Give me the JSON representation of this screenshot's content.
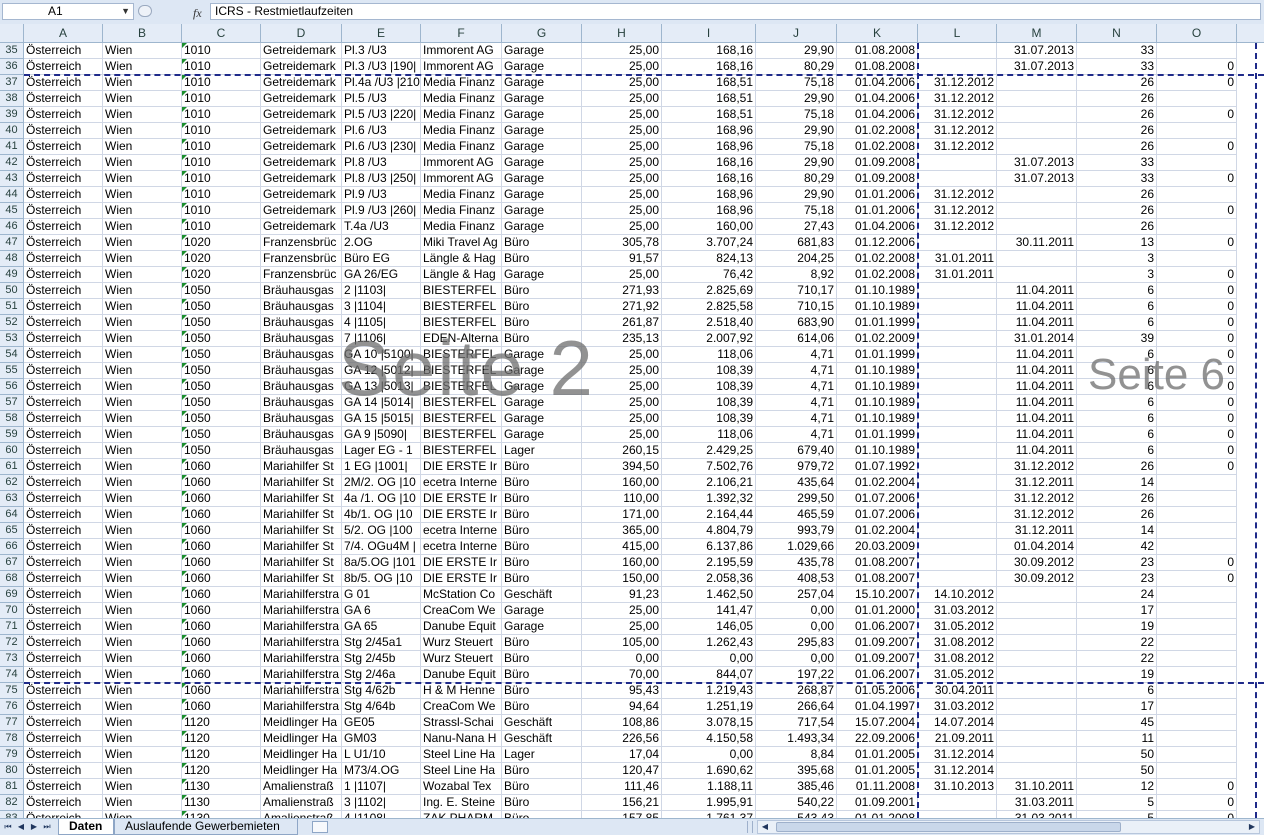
{
  "formula_bar": {
    "cell_ref": "A1",
    "fx": "fx",
    "content": "ICRS - Restmietlaufzeiten"
  },
  "columns": [
    "A",
    "B",
    "C",
    "D",
    "E",
    "F",
    "G",
    "H",
    "I",
    "J",
    "K",
    "L",
    "M",
    "N",
    "O"
  ],
  "rows": [
    {
      "n": "35",
      "a": "Österreich",
      "b": "Wien",
      "c": "1010",
      "d": "Getreidemark",
      "e": "Pl.3 /U3",
      "f": "Immorent AG",
      "g": "Garage",
      "h": "25,00",
      "i": "168,16",
      "j": "29,90",
      "k": "01.08.2008",
      "l": "",
      "m": "31.07.2013",
      "nn": "33",
      "p": ""
    },
    {
      "n": "36",
      "a": "Österreich",
      "b": "Wien",
      "c": "1010",
      "d": "Getreidemark",
      "e": "Pl.3 /U3 |190|",
      "f": "Immorent AG",
      "g": "Garage",
      "h": "25,00",
      "i": "168,16",
      "j": "80,29",
      "k": "01.08.2008",
      "l": "",
      "m": "31.07.2013",
      "nn": "33",
      "p": "0"
    },
    {
      "n": "37",
      "a": "Österreich",
      "b": "Wien",
      "c": "1010",
      "d": "Getreidemark",
      "e": "Pl.4a /U3 |210|",
      "f": "Media Finanz",
      "g": "Garage",
      "h": "25,00",
      "i": "168,51",
      "j": "75,18",
      "k": "01.04.2006",
      "l": "31.12.2012",
      "m": "",
      "nn": "26",
      "p": "0"
    },
    {
      "n": "38",
      "a": "Österreich",
      "b": "Wien",
      "c": "1010",
      "d": "Getreidemark",
      "e": "Pl.5 /U3",
      "f": "Media Finanz",
      "g": "Garage",
      "h": "25,00",
      "i": "168,51",
      "j": "29,90",
      "k": "01.04.2006",
      "l": "31.12.2012",
      "m": "",
      "nn": "26",
      "p": ""
    },
    {
      "n": "39",
      "a": "Österreich",
      "b": "Wien",
      "c": "1010",
      "d": "Getreidemark",
      "e": "Pl.5 /U3 |220|",
      "f": "Media Finanz",
      "g": "Garage",
      "h": "25,00",
      "i": "168,51",
      "j": "75,18",
      "k": "01.04.2006",
      "l": "31.12.2012",
      "m": "",
      "nn": "26",
      "p": "0"
    },
    {
      "n": "40",
      "a": "Österreich",
      "b": "Wien",
      "c": "1010",
      "d": "Getreidemark",
      "e": "Pl.6 /U3",
      "f": "Media Finanz",
      "g": "Garage",
      "h": "25,00",
      "i": "168,96",
      "j": "29,90",
      "k": "01.02.2008",
      "l": "31.12.2012",
      "m": "",
      "nn": "26",
      "p": ""
    },
    {
      "n": "41",
      "a": "Österreich",
      "b": "Wien",
      "c": "1010",
      "d": "Getreidemark",
      "e": "Pl.6 /U3 |230|",
      "f": "Media Finanz",
      "g": "Garage",
      "h": "25,00",
      "i": "168,96",
      "j": "75,18",
      "k": "01.02.2008",
      "l": "31.12.2012",
      "m": "",
      "nn": "26",
      "p": "0"
    },
    {
      "n": "42",
      "a": "Österreich",
      "b": "Wien",
      "c": "1010",
      "d": "Getreidemark",
      "e": "Pl.8 /U3",
      "f": "Immorent AG",
      "g": "Garage",
      "h": "25,00",
      "i": "168,16",
      "j": "29,90",
      "k": "01.09.2008",
      "l": "",
      "m": "31.07.2013",
      "nn": "33",
      "p": ""
    },
    {
      "n": "43",
      "a": "Österreich",
      "b": "Wien",
      "c": "1010",
      "d": "Getreidemark",
      "e": "Pl.8 /U3 |250|",
      "f": "Immorent AG",
      "g": "Garage",
      "h": "25,00",
      "i": "168,16",
      "j": "80,29",
      "k": "01.09.2008",
      "l": "",
      "m": "31.07.2013",
      "nn": "33",
      "p": "0"
    },
    {
      "n": "44",
      "a": "Österreich",
      "b": "Wien",
      "c": "1010",
      "d": "Getreidemark",
      "e": "Pl.9 /U3",
      "f": "Media Finanz",
      "g": "Garage",
      "h": "25,00",
      "i": "168,96",
      "j": "29,90",
      "k": "01.01.2006",
      "l": "31.12.2012",
      "m": "",
      "nn": "26",
      "p": ""
    },
    {
      "n": "45",
      "a": "Österreich",
      "b": "Wien",
      "c": "1010",
      "d": "Getreidemark",
      "e": "Pl.9 /U3 |260|",
      "f": "Media Finanz",
      "g": "Garage",
      "h": "25,00",
      "i": "168,96",
      "j": "75,18",
      "k": "01.01.2006",
      "l": "31.12.2012",
      "m": "",
      "nn": "26",
      "p": "0"
    },
    {
      "n": "46",
      "a": "Österreich",
      "b": "Wien",
      "c": "1010",
      "d": "Getreidemark",
      "e": "T.4a /U3",
      "f": "Media Finanz",
      "g": "Garage",
      "h": "25,00",
      "i": "160,00",
      "j": "27,43",
      "k": "01.04.2006",
      "l": "31.12.2012",
      "m": "",
      "nn": "26",
      "p": ""
    },
    {
      "n": "47",
      "a": "Österreich",
      "b": "Wien",
      "c": "1020",
      "d": "Franzensbrüc",
      "e": "2.OG",
      "f": "Miki Travel Ag",
      "g": "Büro",
      "h": "305,78",
      "i": "3.707,24",
      "j": "681,83",
      "k": "01.12.2006",
      "l": "",
      "m": "30.11.2011",
      "nn": "13",
      "p": "0"
    },
    {
      "n": "48",
      "a": "Österreich",
      "b": "Wien",
      "c": "1020",
      "d": "Franzensbrüc",
      "e": "Büro EG",
      "f": "Längle & Hag",
      "g": "Büro",
      "h": "91,57",
      "i": "824,13",
      "j": "204,25",
      "k": "01.02.2008",
      "l": "31.01.2011",
      "m": "",
      "nn": "3",
      "p": ""
    },
    {
      "n": "49",
      "a": "Österreich",
      "b": "Wien",
      "c": "1020",
      "d": "Franzensbrüc",
      "e": "GA 26/EG",
      "f": "Längle & Hag",
      "g": "Garage",
      "h": "25,00",
      "i": "76,42",
      "j": "8,92",
      "k": "01.02.2008",
      "l": "31.01.2011",
      "m": "",
      "nn": "3",
      "p": "0"
    },
    {
      "n": "50",
      "a": "Österreich",
      "b": "Wien",
      "c": "1050",
      "d": "Bräuhausgas",
      "e": "2 |1103|",
      "f": "BIESTERFEL",
      "g": "Büro",
      "h": "271,93",
      "i": "2.825,69",
      "j": "710,17",
      "k": "01.10.1989",
      "l": "",
      "m": "11.04.2011",
      "nn": "6",
      "p": "0"
    },
    {
      "n": "51",
      "a": "Österreich",
      "b": "Wien",
      "c": "1050",
      "d": "Bräuhausgas",
      "e": "3 |1104|",
      "f": "BIESTERFEL",
      "g": "Büro",
      "h": "271,92",
      "i": "2.825,58",
      "j": "710,15",
      "k": "01.10.1989",
      "l": "",
      "m": "11.04.2011",
      "nn": "6",
      "p": "0"
    },
    {
      "n": "52",
      "a": "Österreich",
      "b": "Wien",
      "c": "1050",
      "d": "Bräuhausgas",
      "e": "4 |1105|",
      "f": "BIESTERFEL",
      "g": "Büro",
      "h": "261,87",
      "i": "2.518,40",
      "j": "683,90",
      "k": "01.01.1999",
      "l": "",
      "m": "11.04.2011",
      "nn": "6",
      "p": "0"
    },
    {
      "n": "53",
      "a": "Österreich",
      "b": "Wien",
      "c": "1050",
      "d": "Bräuhausgas",
      "e": "7 |1106|",
      "f": "EDEN-Alterna",
      "g": "Büro",
      "h": "235,13",
      "i": "2.007,92",
      "j": "614,06",
      "k": "01.02.2009",
      "l": "",
      "m": "31.01.2014",
      "nn": "39",
      "p": "0"
    },
    {
      "n": "54",
      "a": "Österreich",
      "b": "Wien",
      "c": "1050",
      "d": "Bräuhausgas",
      "e": "GA 10 |5100|",
      "f": "BIESTERFEL",
      "g": "Garage",
      "h": "25,00",
      "i": "118,06",
      "j": "4,71",
      "k": "01.01.1999",
      "l": "",
      "m": "11.04.2011",
      "nn": "6",
      "p": "0"
    },
    {
      "n": "55",
      "a": "Österreich",
      "b": "Wien",
      "c": "1050",
      "d": "Bräuhausgas",
      "e": "GA 12 |5012|",
      "f": "BIESTERFEL",
      "g": "Garage",
      "h": "25,00",
      "i": "108,39",
      "j": "4,71",
      "k": "01.10.1989",
      "l": "",
      "m": "11.04.2011",
      "nn": "6",
      "p": "0"
    },
    {
      "n": "56",
      "a": "Österreich",
      "b": "Wien",
      "c": "1050",
      "d": "Bräuhausgas",
      "e": "GA 13 |5013|",
      "f": "BIESTERFEL",
      "g": "Garage",
      "h": "25,00",
      "i": "108,39",
      "j": "4,71",
      "k": "01.10.1989",
      "l": "",
      "m": "11.04.2011",
      "nn": "6",
      "p": "0"
    },
    {
      "n": "57",
      "a": "Österreich",
      "b": "Wien",
      "c": "1050",
      "d": "Bräuhausgas",
      "e": "GA 14 |5014|",
      "f": "BIESTERFEL",
      "g": "Garage",
      "h": "25,00",
      "i": "108,39",
      "j": "4,71",
      "k": "01.10.1989",
      "l": "",
      "m": "11.04.2011",
      "nn": "6",
      "p": "0"
    },
    {
      "n": "58",
      "a": "Österreich",
      "b": "Wien",
      "c": "1050",
      "d": "Bräuhausgas",
      "e": "GA 15 |5015|",
      "f": "BIESTERFEL",
      "g": "Garage",
      "h": "25,00",
      "i": "108,39",
      "j": "4,71",
      "k": "01.10.1989",
      "l": "",
      "m": "11.04.2011",
      "nn": "6",
      "p": "0"
    },
    {
      "n": "59",
      "a": "Österreich",
      "b": "Wien",
      "c": "1050",
      "d": "Bräuhausgas",
      "e": "GA 9 |5090|",
      "f": "BIESTERFEL",
      "g": "Garage",
      "h": "25,00",
      "i": "118,06",
      "j": "4,71",
      "k": "01.01.1999",
      "l": "",
      "m": "11.04.2011",
      "nn": "6",
      "p": "0"
    },
    {
      "n": "60",
      "a": "Österreich",
      "b": "Wien",
      "c": "1050",
      "d": "Bräuhausgas",
      "e": "Lager EG - 1",
      "f": "BIESTERFEL",
      "g": "Lager",
      "h": "260,15",
      "i": "2.429,25",
      "j": "679,40",
      "k": "01.10.1989",
      "l": "",
      "m": "11.04.2011",
      "nn": "6",
      "p": "0"
    },
    {
      "n": "61",
      "a": "Österreich",
      "b": "Wien",
      "c": "1060",
      "d": "Mariahilfer St",
      "e": "1 EG |1001|",
      "f": "DIE ERSTE Ir",
      "g": "Büro",
      "h": "394,50",
      "i": "7.502,76",
      "j": "979,72",
      "k": "01.07.1992",
      "l": "",
      "m": "31.12.2012",
      "nn": "26",
      "p": "0"
    },
    {
      "n": "62",
      "a": "Österreich",
      "b": "Wien",
      "c": "1060",
      "d": "Mariahilfer St",
      "e": "2M/2. OG |10",
      "f": "ecetra Interne",
      "g": "Büro",
      "h": "160,00",
      "i": "2.106,21",
      "j": "435,64",
      "k": "01.02.2004",
      "l": "",
      "m": "31.12.2011",
      "nn": "14",
      "p": ""
    },
    {
      "n": "63",
      "a": "Österreich",
      "b": "Wien",
      "c": "1060",
      "d": "Mariahilfer St",
      "e": "4a /1. OG |10",
      "f": "DIE ERSTE Ir",
      "g": "Büro",
      "h": "110,00",
      "i": "1.392,32",
      "j": "299,50",
      "k": "01.07.2006",
      "l": "",
      "m": "31.12.2012",
      "nn": "26",
      "p": ""
    },
    {
      "n": "64",
      "a": "Österreich",
      "b": "Wien",
      "c": "1060",
      "d": "Mariahilfer St",
      "e": "4b/1. OG |10",
      "f": "DIE ERSTE Ir",
      "g": "Büro",
      "h": "171,00",
      "i": "2.164,44",
      "j": "465,59",
      "k": "01.07.2006",
      "l": "",
      "m": "31.12.2012",
      "nn": "26",
      "p": ""
    },
    {
      "n": "65",
      "a": "Österreich",
      "b": "Wien",
      "c": "1060",
      "d": "Mariahilfer St",
      "e": "5/2. OG |100",
      "f": "ecetra Interne",
      "g": "Büro",
      "h": "365,00",
      "i": "4.804,79",
      "j": "993,79",
      "k": "01.02.2004",
      "l": "",
      "m": "31.12.2011",
      "nn": "14",
      "p": ""
    },
    {
      "n": "66",
      "a": "Österreich",
      "b": "Wien",
      "c": "1060",
      "d": "Mariahilfer St",
      "e": "7/4. OGu4M |",
      "f": "ecetra Interne",
      "g": "Büro",
      "h": "415,00",
      "i": "6.137,86",
      "j": "1.029,66",
      "k": "20.03.2009",
      "l": "",
      "m": "01.04.2014",
      "nn": "42",
      "p": ""
    },
    {
      "n": "67",
      "a": "Österreich",
      "b": "Wien",
      "c": "1060",
      "d": "Mariahilfer St",
      "e": "8a/5.OG |101",
      "f": "DIE ERSTE Ir",
      "g": "Büro",
      "h": "160,00",
      "i": "2.195,59",
      "j": "435,78",
      "k": "01.08.2007",
      "l": "",
      "m": "30.09.2012",
      "nn": "23",
      "p": "0"
    },
    {
      "n": "68",
      "a": "Österreich",
      "b": "Wien",
      "c": "1060",
      "d": "Mariahilfer St",
      "e": "8b/5. OG |10",
      "f": "DIE ERSTE Ir",
      "g": "Büro",
      "h": "150,00",
      "i": "2.058,36",
      "j": "408,53",
      "k": "01.08.2007",
      "l": "",
      "m": "30.09.2012",
      "nn": "23",
      "p": "0"
    },
    {
      "n": "69",
      "a": "Österreich",
      "b": "Wien",
      "c": "1060",
      "d": "Mariahilferstra",
      "e": "G 01",
      "f": "McStation Co",
      "g": "Geschäft",
      "h": "91,23",
      "i": "1.462,50",
      "j": "257,04",
      "k": "15.10.2007",
      "l": "14.10.2012",
      "m": "",
      "nn": "24",
      "p": ""
    },
    {
      "n": "70",
      "a": "Österreich",
      "b": "Wien",
      "c": "1060",
      "d": "Mariahilferstra",
      "e": "GA 6",
      "f": "CreaCom We",
      "g": "Garage",
      "h": "25,00",
      "i": "141,47",
      "j": "0,00",
      "k": "01.01.2000",
      "l": "31.03.2012",
      "m": "",
      "nn": "17",
      "p": ""
    },
    {
      "n": "71",
      "a": "Österreich",
      "b": "Wien",
      "c": "1060",
      "d": "Mariahilferstra",
      "e": "GA 65",
      "f": "Danube Equit",
      "g": "Garage",
      "h": "25,00",
      "i": "146,05",
      "j": "0,00",
      "k": "01.06.2007",
      "l": "31.05.2012",
      "m": "",
      "nn": "19",
      "p": ""
    },
    {
      "n": "72",
      "a": "Österreich",
      "b": "Wien",
      "c": "1060",
      "d": "Mariahilferstra",
      "e": "Stg 2/45a1",
      "f": "Wurz Steuert",
      "g": "Büro",
      "h": "105,00",
      "i": "1.262,43",
      "j": "295,83",
      "k": "01.09.2007",
      "l": "31.08.2012",
      "m": "",
      "nn": "22",
      "p": ""
    },
    {
      "n": "73",
      "a": "Österreich",
      "b": "Wien",
      "c": "1060",
      "d": "Mariahilferstra",
      "e": "Stg 2/45b",
      "f": "Wurz Steuert",
      "g": "Büro",
      "h": "0,00",
      "i": "0,00",
      "j": "0,00",
      "k": "01.09.2007",
      "l": "31.08.2012",
      "m": "",
      "nn": "22",
      "p": ""
    },
    {
      "n": "74",
      "a": "Österreich",
      "b": "Wien",
      "c": "1060",
      "d": "Mariahilferstra",
      "e": "Stg 2/46a",
      "f": "Danube Equit",
      "g": "Büro",
      "h": "70,00",
      "i": "844,07",
      "j": "197,22",
      "k": "01.06.2007",
      "l": "31.05.2012",
      "m": "",
      "nn": "19",
      "p": ""
    },
    {
      "n": "75",
      "a": "Österreich",
      "b": "Wien",
      "c": "1060",
      "d": "Mariahilferstra",
      "e": "Stg 4/62b",
      "f": "H & M Henne",
      "g": "Büro",
      "h": "95,43",
      "i": "1.219,43",
      "j": "268,87",
      "k": "01.05.2006",
      "l": "30.04.2011",
      "m": "",
      "nn": "6",
      "p": ""
    },
    {
      "n": "76",
      "a": "Österreich",
      "b": "Wien",
      "c": "1060",
      "d": "Mariahilferstra",
      "e": "Stg 4/64b",
      "f": "CreaCom We",
      "g": "Büro",
      "h": "94,64",
      "i": "1.251,19",
      "j": "266,64",
      "k": "01.04.1997",
      "l": "31.03.2012",
      "m": "",
      "nn": "17",
      "p": ""
    },
    {
      "n": "77",
      "a": "Österreich",
      "b": "Wien",
      "c": "1120",
      "d": "Meidlinger Ha",
      "e": "GE05",
      "f": "Strassl-Schai",
      "g": "Geschäft",
      "h": "108,86",
      "i": "3.078,15",
      "j": "717,54",
      "k": "15.07.2004",
      "l": "14.07.2014",
      "m": "",
      "nn": "45",
      "p": ""
    },
    {
      "n": "78",
      "a": "Österreich",
      "b": "Wien",
      "c": "1120",
      "d": "Meidlinger Ha",
      "e": "GM03",
      "f": "Nanu-Nana H",
      "g": "Geschäft",
      "h": "226,56",
      "i": "4.150,58",
      "j": "1.493,34",
      "k": "22.09.2006",
      "l": "21.09.2011",
      "m": "",
      "nn": "11",
      "p": ""
    },
    {
      "n": "79",
      "a": "Österreich",
      "b": "Wien",
      "c": "1120",
      "d": "Meidlinger Ha",
      "e": "L U1/10",
      "f": "Steel Line Ha",
      "g": "Lager",
      "h": "17,04",
      "i": "0,00",
      "j": "8,84",
      "k": "01.01.2005",
      "l": "31.12.2014",
      "m": "",
      "nn": "50",
      "p": ""
    },
    {
      "n": "80",
      "a": "Österreich",
      "b": "Wien",
      "c": "1120",
      "d": "Meidlinger Ha",
      "e": "M73/4.OG",
      "f": "Steel Line Ha",
      "g": "Büro",
      "h": "120,47",
      "i": "1.690,62",
      "j": "395,68",
      "k": "01.01.2005",
      "l": "31.12.2014",
      "m": "",
      "nn": "50",
      "p": ""
    },
    {
      "n": "81",
      "a": "Österreich",
      "b": "Wien",
      "c": "1130",
      "d": "Amalienstraß",
      "e": "1 |1107|",
      "f": "Wozabal Tex",
      "g": "Büro",
      "h": "111,46",
      "i": "1.188,11",
      "j": "385,46",
      "k": "01.11.2008",
      "l": "31.10.2013",
      "m": "31.10.2011",
      "nn": "12",
      "p": "0"
    },
    {
      "n": "82",
      "a": "Österreich",
      "b": "Wien",
      "c": "1130",
      "d": "Amalienstraß",
      "e": "3 |1102|",
      "f": "Ing. E. Steine",
      "g": "Büro",
      "h": "156,21",
      "i": "1.995,91",
      "j": "540,22",
      "k": "01.09.2001",
      "l": "",
      "m": "31.03.2011",
      "nn": "5",
      "p": "0"
    },
    {
      "n": "83",
      "a": "Österreich",
      "b": "Wien",
      "c": "1130",
      "d": "Amalienstraß",
      "e": "4 |1108|",
      "f": "ZAK PHARM",
      "g": "Büro",
      "h": "157,85",
      "i": "1.761,37",
      "j": "543,43",
      "k": "01.01.2008",
      "l": "",
      "m": "31.03.2011",
      "nn": "5",
      "p": "0"
    }
  ],
  "watermarks": {
    "page_a": "Seite 2",
    "page_b": "Seite 6"
  },
  "sheet_tabs": [
    "Daten",
    "Auslaufende Gewerbemieten"
  ]
}
